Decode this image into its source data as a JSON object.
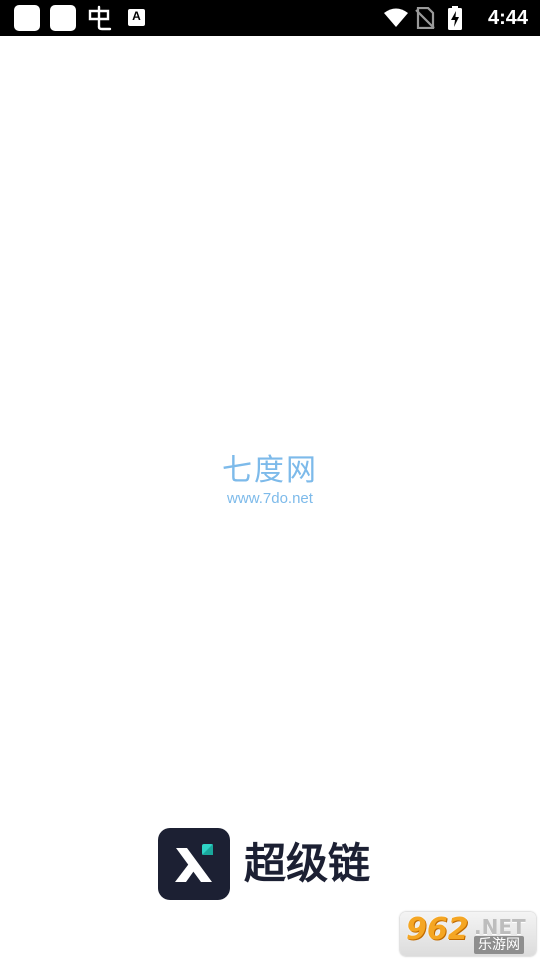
{
  "status_bar": {
    "time": "4:44",
    "left_icons": [
      "app-notification-icon",
      "app-notification-icon",
      "bug-icon",
      "a-notification-icon"
    ],
    "right_icons": [
      "wifi-icon",
      "no-sim-icon",
      "battery-charging-icon"
    ],
    "a_icon_letter": "A"
  },
  "watermark": {
    "title": "七度网",
    "url": "www.7do.net",
    "color": "#6fb3e8"
  },
  "brand": {
    "name": "超级链",
    "logo_icon": "x-logo-icon",
    "dark_color": "#1c2033",
    "accent_color": "#2ed3c6"
  },
  "corner_badge": {
    "number": "962",
    "suffix": ".NET",
    "subtitle": "乐游网",
    "number_color": "#f5a623"
  }
}
